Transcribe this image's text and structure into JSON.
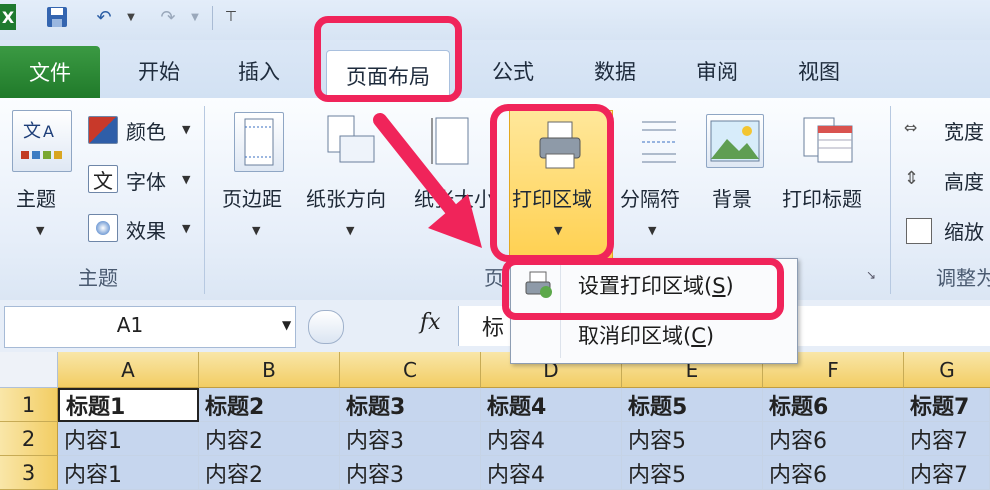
{
  "app": {
    "title": "Microsoft Excel"
  },
  "ribbon_tabs": [
    {
      "label": "文件"
    },
    {
      "label": "开始"
    },
    {
      "label": "插入"
    },
    {
      "label": "页面布局"
    },
    {
      "label": "公式"
    },
    {
      "label": "数据"
    },
    {
      "label": "审阅"
    },
    {
      "label": "视图"
    }
  ],
  "theme_group": {
    "theme_button": "主题",
    "colors": "颜色",
    "fonts": "字体",
    "effects": "效果",
    "group_label": "主题"
  },
  "page_setup_group": {
    "margins": "页边距",
    "orientation": "纸张方向",
    "size": "纸张大小",
    "print_area": "打印区域",
    "breaks": "分隔符",
    "background": "背景",
    "print_titles": "打印标题",
    "group_label": "页"
  },
  "scale_group": {
    "width": "宽度",
    "height": "高度",
    "scale": "缩放",
    "group_label": "调整为"
  },
  "print_area_menu": [
    {
      "label": "设置打印区域(S)",
      "text": "设置打印区域(",
      "key": "S",
      "tail": ")"
    },
    {
      "label": "取消印区域(C)",
      "text": "取消印区域(",
      "key": "C",
      "tail": ")"
    }
  ],
  "formula_bar": {
    "name_box": "A1",
    "fx": "fx",
    "content": "标"
  },
  "sheet": {
    "columns": [
      "A",
      "B",
      "C",
      "D",
      "E",
      "F",
      "G"
    ],
    "rows": [
      {
        "num": "1",
        "cells": [
          "标题1",
          "标题2",
          "标题3",
          "标题4",
          "标题5",
          "标题6",
          "标题7"
        ]
      },
      {
        "num": "2",
        "cells": [
          "内容1",
          "内容2",
          "内容3",
          "内容4",
          "内容5",
          "内容6",
          "内容7"
        ]
      },
      {
        "num": "3",
        "cells": [
          "内容1",
          "内容2",
          "内容3",
          "内容4",
          "内容5",
          "内容6",
          "内容7"
        ]
      }
    ]
  },
  "colors": {
    "annotation": "#f0245a",
    "file_tab": "#2f8a38",
    "selection": "#c6d6ee",
    "header_selected": "#f2cd63"
  }
}
